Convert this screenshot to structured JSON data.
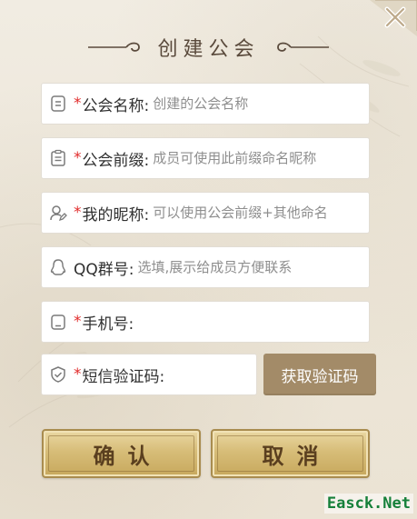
{
  "dialog": {
    "title": "创建公会",
    "close_icon": "close-x-icon"
  },
  "form": {
    "guild_name": {
      "icon": "document-icon",
      "required_mark": "*",
      "label": "公会名称:",
      "placeholder": "创建的公会名称",
      "value": ""
    },
    "guild_prefix": {
      "icon": "clipboard-icon",
      "required_mark": "*",
      "label": "公会前缀:",
      "placeholder": "成员可使用此前缀命名昵称",
      "value": ""
    },
    "nickname": {
      "icon": "user-edit-icon",
      "required_mark": "*",
      "label": "我的昵称:",
      "placeholder": "可以使用公会前缀+其他命名",
      "value": ""
    },
    "qq_group": {
      "icon": "qq-penguin-icon",
      "label": "QQ群号:",
      "placeholder": "选填,展示给成员方便联系",
      "value": ""
    },
    "phone": {
      "icon": "phone-icon",
      "required_mark": "*",
      "label": "手机号:",
      "placeholder": "",
      "value": ""
    },
    "sms_code": {
      "icon": "shield-check-icon",
      "required_mark": "*",
      "label": "短信验证码:",
      "placeholder": "",
      "value": "",
      "get_code_label": "获取验证码"
    }
  },
  "actions": {
    "confirm_label": "确认",
    "cancel_label": "取消"
  },
  "watermark": "Easck.Net",
  "colors": {
    "required": "#e12b2b",
    "code_button": "#a38b68",
    "gold_button": "#d7bd78",
    "title_text": "#5a4a3c",
    "watermark": "#16803a"
  }
}
